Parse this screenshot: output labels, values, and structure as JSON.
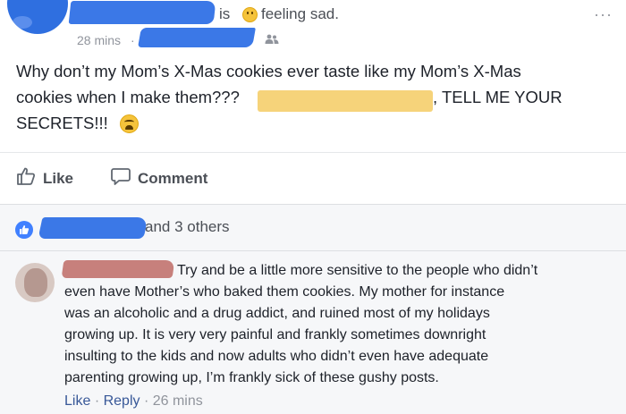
{
  "post": {
    "header_is": "is",
    "feeling": "feeling sad.",
    "time": "28 mins",
    "time_separator": "·",
    "menu": "···",
    "text_lines": [
      "Why don’t my Mom’s X-Mas cookies ever taste like my Mom’s X-Mas",
      "cookies when I make them???",
      ", TELL ME YOUR",
      "SECRETS!!!"
    ]
  },
  "actions": {
    "like_label": "Like",
    "comment_label": "Comment"
  },
  "reactions": {
    "likes_text": "and 3 others"
  },
  "comment": {
    "lines": [
      "Try and be a little more sensitive to the people who didn’t",
      "even have Mother’s who baked them cookies. My mother for instance",
      "was an alcoholic and a drug addict, and ruined most of my holidays",
      "growing up. It is very very painful and frankly sometimes downright",
      "insulting to the kids and now adults who didn’t even have adequate",
      "parenting growing up, I’m frankly sick of these gushy posts."
    ],
    "like_label": "Like",
    "reply_label": "Reply",
    "separator": "·",
    "time": "26 mins"
  },
  "colors": {
    "facebook_blue": "#4080ff",
    "link_blue": "#385898",
    "meta_gray": "#90949c",
    "text": "#1d2129"
  },
  "icons": {
    "like": "thumbs-up-icon",
    "comment": "speech-bubble-icon",
    "audience": "friends-icon",
    "sad_emoji": "sad-face-icon",
    "tired_emoji": "tired-face-icon"
  }
}
